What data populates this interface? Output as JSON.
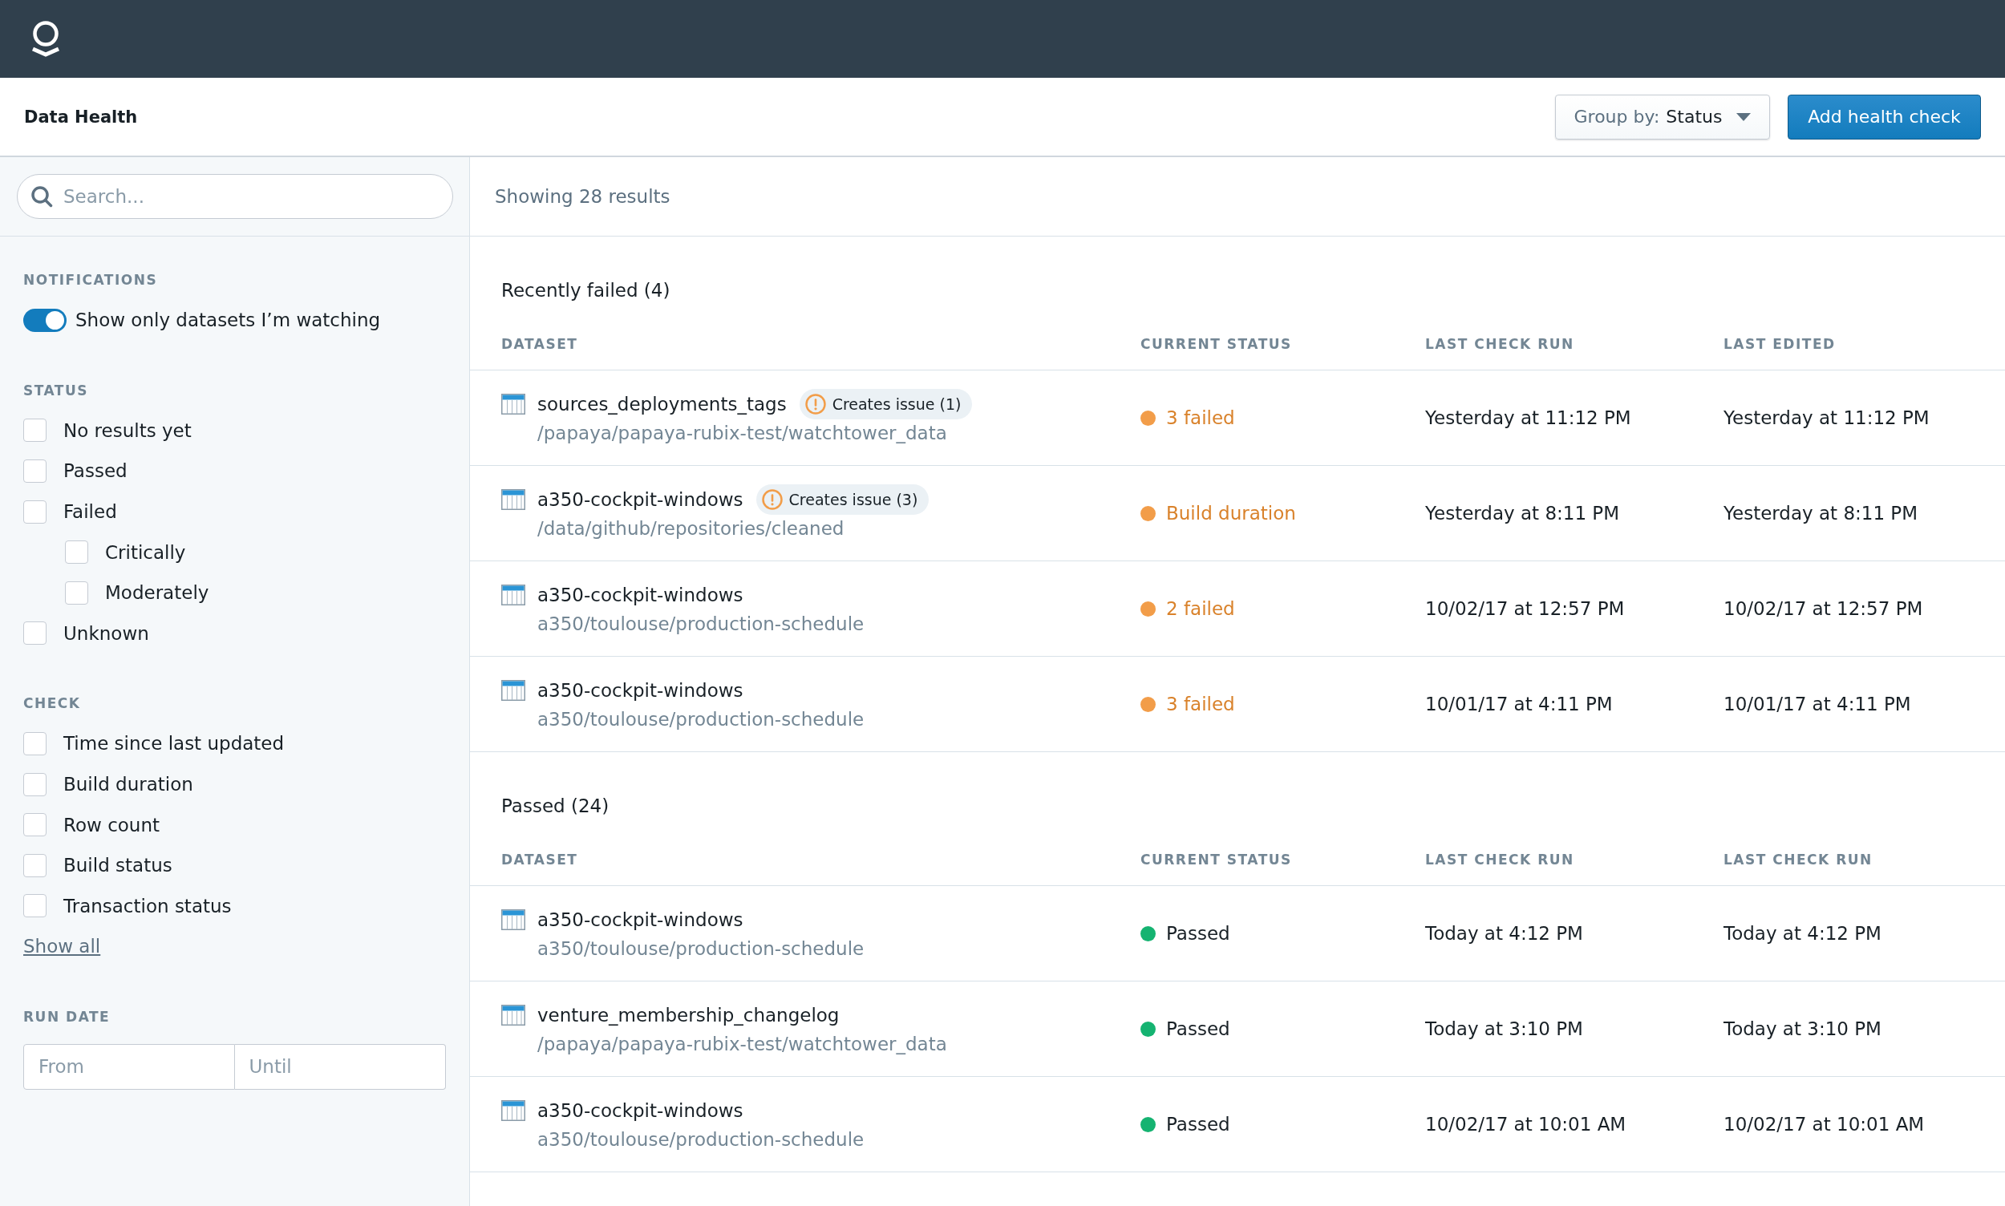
{
  "header": {
    "title": "Data Health",
    "group_by": {
      "label": "Group by:",
      "value": "Status"
    },
    "add_button": "Add health check"
  },
  "sidebar": {
    "search": {
      "placeholder": "Search..."
    },
    "notifications": {
      "title": "NOTIFICATIONS",
      "toggle": {
        "label": "Show only datasets I’m watching",
        "on": true
      }
    },
    "status_filter": {
      "title": "STATUS",
      "options": [
        {
          "label": "No results yet",
          "checked": false
        },
        {
          "label": "Passed",
          "checked": false
        },
        {
          "label": "Failed",
          "checked": false,
          "children": [
            {
              "label": "Critically",
              "checked": false
            },
            {
              "label": "Moderately",
              "checked": false
            }
          ]
        },
        {
          "label": "Unknown",
          "checked": false
        }
      ]
    },
    "check_filter": {
      "title": "CHECK",
      "options": [
        {
          "label": "Time since last updated",
          "checked": false
        },
        {
          "label": "Build duration",
          "checked": false
        },
        {
          "label": "Row count",
          "checked": false
        },
        {
          "label": "Build status",
          "checked": false
        },
        {
          "label": "Transaction status",
          "checked": false
        }
      ],
      "show_all": "Show all"
    },
    "run_date": {
      "title": "RUN DATE",
      "from": {
        "placeholder": "From"
      },
      "until": {
        "placeholder": "Until"
      }
    }
  },
  "results": {
    "summary": "Showing 28 results",
    "groups": [
      {
        "title": "Recently failed (4)",
        "columns": [
          "DATASET",
          "CURRENT STATUS",
          "LAST CHECK RUN",
          "LAST EDITED"
        ],
        "rows": [
          {
            "name": "sources_deployments_tags",
            "path": "/papaya/papaya-rubix-test/watchtower_data",
            "issue": "Creates issue (1)",
            "status": {
              "label": "3 failed",
              "kind": "failed",
              "color": "#f29d49"
            },
            "dates": [
              "Yesterday at 11:12 PM",
              "Yesterday at 11:12 PM"
            ]
          },
          {
            "name": "a350-cockpit-windows",
            "path": "/data/github/repositories/cleaned",
            "issue": "Creates issue (3)",
            "status": {
              "label": "Build duration",
              "kind": "failed",
              "color": "#f29d49"
            },
            "dates": [
              "Yesterday at 8:11 PM",
              "Yesterday at 8:11 PM"
            ]
          },
          {
            "name": "a350-cockpit-windows",
            "path": "a350/toulouse/production-schedule",
            "status": {
              "label": "2 failed",
              "kind": "failed",
              "color": "#f29d49"
            },
            "dates": [
              "10/02/17 at 12:57 PM",
              "10/02/17 at 12:57 PM"
            ]
          },
          {
            "name": "a350-cockpit-windows",
            "path": "a350/toulouse/production-schedule",
            "status": {
              "label": "3 failed",
              "kind": "failed",
              "color": "#f29d49"
            },
            "dates": [
              "10/01/17 at 4:11 PM",
              "10/01/17 at 4:11 PM"
            ]
          }
        ]
      },
      {
        "title": "Passed (24)",
        "columns": [
          "DATASET",
          "CURRENT STATUS",
          "LAST CHECK RUN",
          "LAST CHECK RUN"
        ],
        "rows": [
          {
            "name": "a350-cockpit-windows",
            "path": "a350/toulouse/production-schedule",
            "status": {
              "label": "Passed",
              "kind": "passed",
              "color": "#15b371"
            },
            "dates": [
              "Today at 4:12 PM",
              "Today at 4:12 PM"
            ]
          },
          {
            "name": "venture_membership_changelog",
            "path": "/papaya/papaya-rubix-test/watchtower_data",
            "status": {
              "label": "Passed",
              "kind": "passed",
              "color": "#15b371"
            },
            "dates": [
              "Today at 3:10 PM",
              "Today at 3:10 PM"
            ]
          },
          {
            "name": "a350-cockpit-windows",
            "path": "a350/toulouse/production-schedule",
            "status": {
              "label": "Passed",
              "kind": "passed",
              "color": "#15b371"
            },
            "dates": [
              "10/02/17 at 10:01 AM",
              "10/02/17 at 10:01 AM"
            ]
          }
        ]
      }
    ]
  }
}
